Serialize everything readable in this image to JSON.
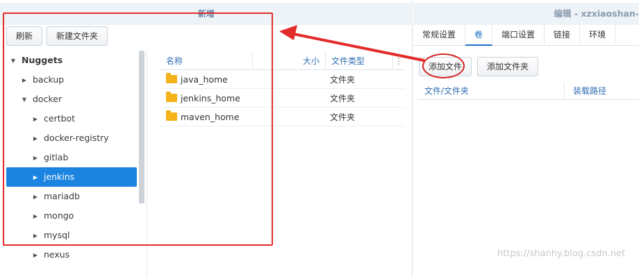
{
  "dialog": {
    "title": "新增",
    "refresh_label": "刷新",
    "new_folder_label": "新建文件夹",
    "tree": [
      {
        "label": "Nuggets",
        "arrow": "▼",
        "bold": true,
        "indent": 0
      },
      {
        "label": "backup",
        "arrow": "▶",
        "indent": 1
      },
      {
        "label": "docker",
        "arrow": "▼",
        "indent": 1
      },
      {
        "label": "certbot",
        "arrow": "▶",
        "indent": 2
      },
      {
        "label": "docker-registry",
        "arrow": "▶",
        "indent": 2
      },
      {
        "label": "gitlab",
        "arrow": "▶",
        "indent": 2
      },
      {
        "label": "jenkins",
        "arrow": "▶",
        "indent": 2,
        "selected": true
      },
      {
        "label": "mariadb",
        "arrow": "▶",
        "indent": 2
      },
      {
        "label": "mongo",
        "arrow": "▶",
        "indent": 2
      },
      {
        "label": "mysql",
        "arrow": "▶",
        "indent": 2
      },
      {
        "label": "nexus",
        "arrow": "▶",
        "indent": 2
      }
    ],
    "columns": {
      "name": "名称",
      "size": "大小",
      "type": "文件类型",
      "more": "⋮"
    },
    "files": [
      {
        "name": "java_home",
        "type": "文件夹"
      },
      {
        "name": "jenkins_home",
        "type": "文件夹"
      },
      {
        "name": "maven_home",
        "type": "文件夹"
      }
    ]
  },
  "edit_panel": {
    "title": "编辑 - xzxiaoshan-",
    "tabs": [
      "常规设置",
      "卷",
      "端口设置",
      "链接",
      "环境"
    ],
    "active_tab": "卷",
    "add_file_label": "添加文件",
    "add_folder_label": "添加文件夹",
    "columns": {
      "file_folder": "文件/文件夹",
      "mount_path": "装载路径"
    }
  },
  "watermark": "https://shanhy.blog.csdn.net",
  "colors": {
    "selection": "#1a84e0",
    "annotation": "#e32b2b",
    "folder": "#f5b31b",
    "header_text": "#2f6fb5"
  }
}
